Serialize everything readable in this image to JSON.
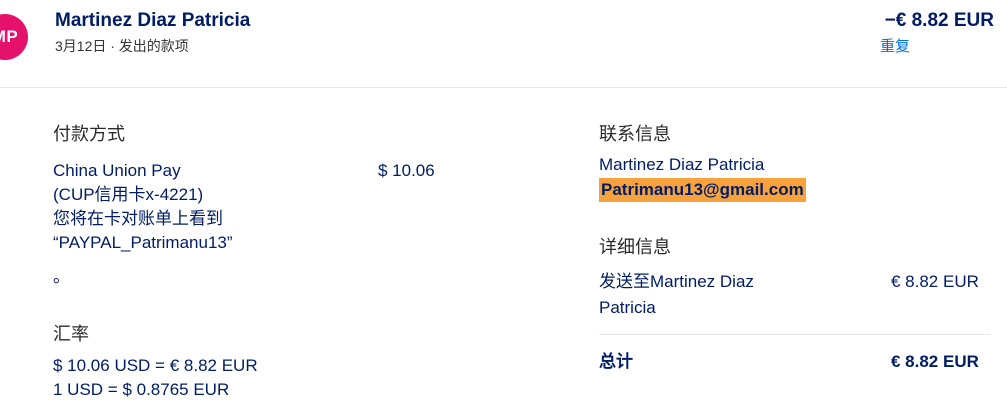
{
  "header": {
    "avatar_initials": "MP",
    "name": "Martinez Diaz Patricia",
    "subline": "3月12日 · 发出的款项",
    "amount": "−€ 8.82 EUR",
    "repeat_label": "重复"
  },
  "payment": {
    "title": "付款方式",
    "method_line1": "China Union Pay",
    "method_line2": "(CUP信用卡x-4221)",
    "statement_line1": "您将在卡对账单上看到",
    "statement_line2": "“PAYPAL_Patrimanu13”",
    "statement_line3": "。",
    "amount": "$ 10.06"
  },
  "exchange": {
    "title": "汇率",
    "line1": "$ 10.06 USD = € 8.82 EUR",
    "line2": "1 USD = $ 0.8765 EUR"
  },
  "contact": {
    "title": "联系信息",
    "name": "Martinez Diaz Patricia",
    "email": "Patrimanu13@gmail.com"
  },
  "details": {
    "title": "详细信息",
    "sent_to_line1": "发送至Martinez Diaz",
    "sent_to_line2": "Patricia",
    "sent_amount": "€ 8.82 EUR",
    "total_label": "总计",
    "total_amount": "€ 8.82 EUR"
  },
  "colors": {
    "avatar_bg": "#e5126d",
    "link": "#0070e0",
    "email_highlight": "#f7a23d",
    "text_primary": "#001c64"
  }
}
